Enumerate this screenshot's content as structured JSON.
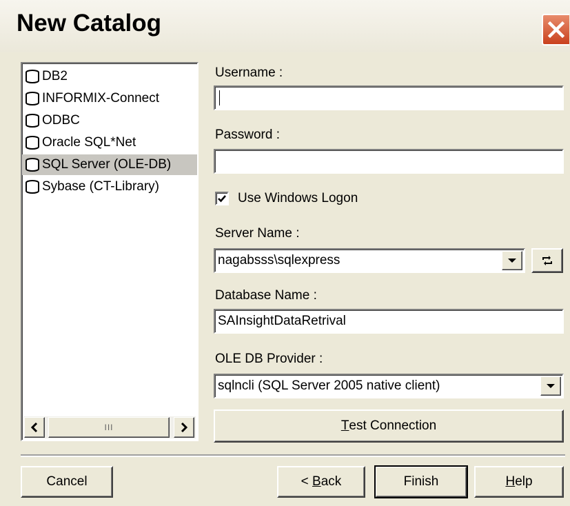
{
  "window": {
    "title": "New Catalog"
  },
  "catalog_types": {
    "items": [
      {
        "label": "DB2"
      },
      {
        "label": "INFORMIX-Connect"
      },
      {
        "label": "ODBC"
      },
      {
        "label": "Oracle SQL*Net"
      },
      {
        "label": "SQL Server (OLE-DB)"
      },
      {
        "label": "Sybase (CT-Library)"
      }
    ],
    "selected": "SQL Server (OLE-DB)",
    "scroll_thumb_glyph": "III"
  },
  "form": {
    "username": {
      "label": "Username :",
      "value": ""
    },
    "password": {
      "label": "Password :",
      "value": ""
    },
    "use_windows_logon": {
      "label": "Use Windows Logon",
      "checked": true
    },
    "server_name": {
      "label": "Server Name :",
      "value": "nagabsss\\sqlexpress"
    },
    "database_name": {
      "label": "Database Name :",
      "value": "SAInsightDataRetrival"
    },
    "ole_db_provider": {
      "label": "OLE DB Provider :",
      "value": "sqlncli (SQL Server 2005 native client)"
    },
    "test_connection": {
      "prefix": "T",
      "rest": "est Connection"
    }
  },
  "buttons": {
    "cancel": {
      "label": "Cancel"
    },
    "back": {
      "prefix": "< ",
      "accel": "B",
      "rest": "ack"
    },
    "finish": {
      "label": "Finish"
    },
    "help": {
      "accel": "H",
      "rest": "elp"
    }
  },
  "icons": {
    "list_item": "database-icon",
    "close": "close-icon",
    "refresh": "refresh-icon",
    "dropdown": "chevron-down-icon",
    "scroll_left": "arrow-left-icon",
    "scroll_right": "arrow-right-icon",
    "check": "checkmark-icon"
  },
  "colors": {
    "dialog_bg": "#ece9d8",
    "close_button": "#c9411d",
    "selection": "#c8c6c0"
  }
}
